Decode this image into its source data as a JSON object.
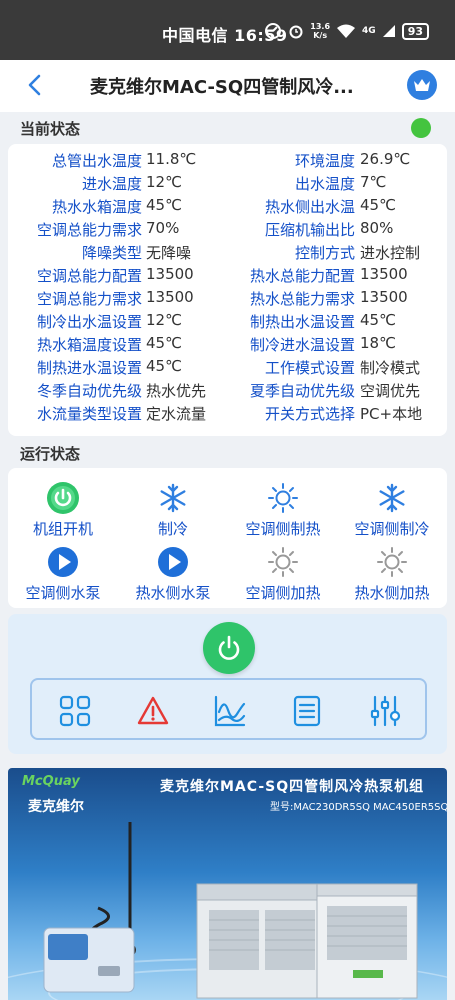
{
  "statusbar": {
    "carrier_time": "中国电信 16:59",
    "speed_top": "13.6",
    "speed_bottom": "K/s",
    "signal": "4G",
    "battery": "93"
  },
  "nav": {
    "title": "麦克维尔MAC-SQ四管制风冷...",
    "back_icon": "chevron-left-icon",
    "crown_icon": "crown-icon"
  },
  "current": {
    "heading": "当前状态",
    "indicator_color": "#44c43f",
    "rows": [
      {
        "l": "总管出水温度",
        "lv": "11.8℃",
        "r": "环境温度",
        "rv": "26.9℃"
      },
      {
        "l": "进水温度",
        "lv": "12℃",
        "r": "出水温度",
        "rv": "7℃"
      },
      {
        "l": "热水水箱温度",
        "lv": "45℃",
        "r": "热水侧出水温",
        "rv": "45℃"
      },
      {
        "l": "空调总能力需求",
        "lv": "70%",
        "r": "压缩机输出比",
        "rv": "80%"
      },
      {
        "l": "降噪类型",
        "lv": "无降噪",
        "r": "控制方式",
        "rv": "进水控制"
      },
      {
        "l": "空调总能力配置",
        "lv": "13500",
        "r": "热水总能力配置",
        "rv": "13500"
      },
      {
        "l": "空调总能力需求",
        "lv": "13500",
        "r": "热水总能力需求",
        "rv": "13500"
      },
      {
        "l": "制冷出水温设置",
        "lv": "12℃",
        "r": "制热出水温设置",
        "rv": "45℃"
      },
      {
        "l": "热水箱温度设置",
        "lv": "45℃",
        "r": "制冷进水温设置",
        "rv": "18℃"
      },
      {
        "l": "制热进水温设置",
        "lv": "45℃",
        "r": "工作模式设置",
        "rv": "制冷模式"
      },
      {
        "l": "冬季自动优先级",
        "lv": "热水优先",
        "r": "夏季自动优先级",
        "rv": "空调优先"
      },
      {
        "l": "水流量类型设置",
        "lv": "定水流量",
        "r": "开关方式选择",
        "rv": "PC+本地"
      }
    ]
  },
  "running": {
    "heading": "运行状态",
    "items": [
      {
        "label": "机组开机",
        "icon": "power-on-icon",
        "active": true
      },
      {
        "label": "制冷",
        "icon": "snowflake-icon",
        "active": true
      },
      {
        "label": "空调侧制热",
        "icon": "sun-icon",
        "active": true
      },
      {
        "label": "空调侧制冷",
        "icon": "snowflake-icon",
        "active": true
      },
      {
        "label": "空调侧水泵",
        "icon": "pump-icon",
        "active": true
      },
      {
        "label": "热水侧水泵",
        "icon": "pump-icon",
        "active": true
      },
      {
        "label": "空调侧加热",
        "icon": "heater-icon",
        "active": false
      },
      {
        "label": "热水侧加热",
        "icon": "heater-icon",
        "active": false
      }
    ]
  },
  "controls": {
    "power_icon": "power-icon",
    "tools": [
      "grid-icon",
      "alarm-icon",
      "trend-chart-icon",
      "list-icon",
      "sliders-icon"
    ]
  },
  "banner": {
    "logo_en": "McQuay",
    "logo_cn": "麦克维尔",
    "title": "麦克维尔MAC-SQ四管制风冷热泵机组",
    "model": "型号:MAC230DR5SQ  MAC450ER5SQ"
  },
  "colors": {
    "accent": "#1450c8",
    "active_icon": "#2f7fe0",
    "inactive_icon": "#999999",
    "power_green": "#2fc46a",
    "alarm_red": "#e53935"
  }
}
